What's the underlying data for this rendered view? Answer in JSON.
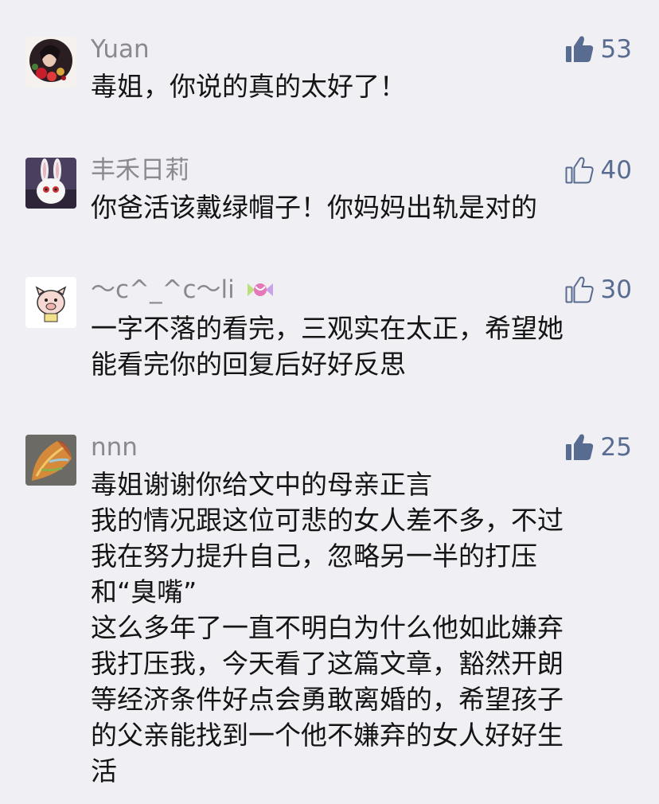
{
  "comments": [
    {
      "user": "Yuan",
      "avatar": "woman-with-flowers-avatar",
      "likes": "53",
      "liked": true,
      "lines": [
        "毒姐，你说的真的太好了！"
      ]
    },
    {
      "user": "丰禾日莉",
      "avatar": "white-rabbit-avatar",
      "likes": "40",
      "liked": false,
      "lines": [
        "你爸活该戴绿帽子！你妈妈出轨是对的"
      ]
    },
    {
      "user": "～c^_^c～li",
      "avatar": "pig-cartoon-avatar",
      "likes": "30",
      "liked": false,
      "lines": [
        "一字不落的看完，三观实在太正，希望她",
        "能看完你的回复后好好反思"
      ]
    },
    {
      "user": "nnn",
      "avatar": "leaf-avatar",
      "likes": "25",
      "liked": true,
      "lines": [
        "毒姐谢谢你给文中的母亲正言",
        "我的情况跟这位可悲的女人差不多，不过",
        "我在努力提升自己，忽略另一半的打压",
        "和“臭嘴”",
        "这么多年了一直不明白为什么他如此嫌弃",
        "我打压我，今天看了这篇文章，豁然开朗",
        "等经济条件好点会勇敢离婚的，希望孩子",
        "的父亲能找到一个他不嫌弃的女人好好生",
        "活"
      ]
    }
  ],
  "colors": {
    "background": "#efeff4",
    "like": "#586b90",
    "name": "#8a8a8e",
    "text": "#141414"
  }
}
